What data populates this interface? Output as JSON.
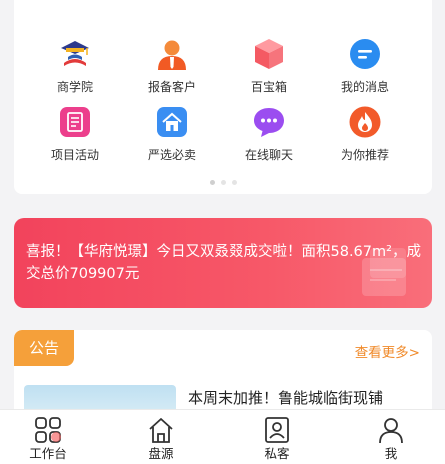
{
  "grid": {
    "items": [
      {
        "label": "商学院",
        "icon": "academy-icon"
      },
      {
        "label": "报备客户",
        "icon": "customer-report-icon"
      },
      {
        "label": "百宝箱",
        "icon": "treasure-box-icon"
      },
      {
        "label": "我的消息",
        "icon": "message-icon"
      },
      {
        "label": "项目活动",
        "icon": "project-activity-icon"
      },
      {
        "label": "严选必卖",
        "icon": "selected-house-icon"
      },
      {
        "label": "在线聊天",
        "icon": "chat-icon"
      },
      {
        "label": "为你推荐",
        "icon": "recommend-icon"
      }
    ],
    "page_indicator": {
      "pages": 3,
      "current": 1
    }
  },
  "banner": {
    "text": "喜报！【华府悦璟】今日又双叒叕成交啦！面积58.67m²，成交总价709907元"
  },
  "notice": {
    "tag": "公告",
    "more": "查看更多>",
    "item_title": "本周末加推！鲁能城临街现铺"
  },
  "tabbar": {
    "tabs": [
      {
        "label": "工作台",
        "icon": "workbench-icon"
      },
      {
        "label": "盘源",
        "icon": "house-icon"
      },
      {
        "label": "私客",
        "icon": "contact-card-icon"
      },
      {
        "label": "我",
        "icon": "person-icon"
      }
    ]
  },
  "colors": {
    "banner": "#f2435c",
    "notice_tag": "#f5a03a",
    "notice_more": "#f08a2a"
  }
}
